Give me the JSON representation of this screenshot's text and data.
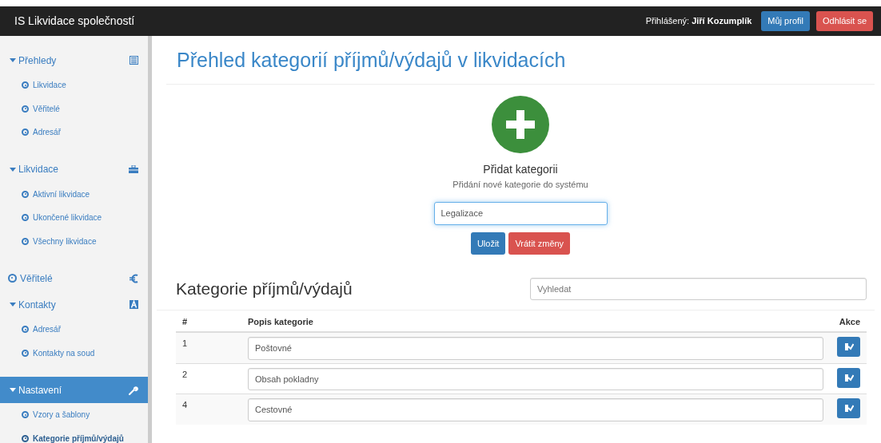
{
  "navbar": {
    "brand": "IS Likvidace společností",
    "login_label": "Přihlášený:",
    "user": "Jiří Kozumplík",
    "buttons": [
      {
        "label": "Můj profil",
        "kind": "primary"
      },
      {
        "label": "Odhlásit se",
        "kind": "danger"
      }
    ]
  },
  "sidebar": {
    "sections": [
      {
        "kind": "group",
        "label": "Přehledy",
        "expanded": true,
        "selected": false,
        "children": [
          {
            "label": "Likvidace",
            "selected": false
          },
          {
            "label": "Věřitelé",
            "selected": false
          },
          {
            "label": "Adresář",
            "selected": false
          }
        ]
      },
      {
        "kind": "group",
        "label": "Likvidace",
        "expanded": true,
        "selected": false,
        "children": [
          {
            "label": "Aktivní likvidace",
            "selected": false
          },
          {
            "label": "Ukončené likvidace",
            "selected": false
          },
          {
            "label": "Všechny likvidace",
            "selected": false
          }
        ]
      },
      {
        "kind": "link",
        "label": "Věřitelé",
        "selected": false
      },
      {
        "kind": "group",
        "label": "Kontakty",
        "expanded": true,
        "selected": false,
        "children": [
          {
            "label": "Adresář",
            "selected": false
          },
          {
            "label": "Kontakty na soud",
            "selected": false
          }
        ]
      },
      {
        "kind": "group",
        "label": "Nastavení",
        "expanded": true,
        "selected": true,
        "children": [
          {
            "label": "Vzory a šablony",
            "selected": false
          },
          {
            "label": "Kategorie příjmů/výdajů",
            "selected": true
          }
        ]
      }
    ]
  },
  "page_title": "Přehled kategorií příjmů/výdajů v likvidacích",
  "add_panel": {
    "title": "Přidat kategorii",
    "subtitle": "Přidání nové kategorie do systému",
    "input_value": "Legalizace",
    "buttons": [
      {
        "label": "Uložit",
        "kind": "primary"
      },
      {
        "label": "Vrátit změny",
        "kind": "danger"
      }
    ]
  },
  "list": {
    "heading": "Kategorie příjmů/výdajů",
    "search_placeholder": "Vyhledat",
    "table": {
      "columns": [
        "#",
        "Popis kategorie",
        "Akce"
      ],
      "rows": [
        {
          "number": "1",
          "description": "Poštovné"
        },
        {
          "number": "2",
          "description": "Obsah pokladny"
        },
        {
          "number": "4",
          "description": "Cestovné"
        }
      ]
    }
  }
}
